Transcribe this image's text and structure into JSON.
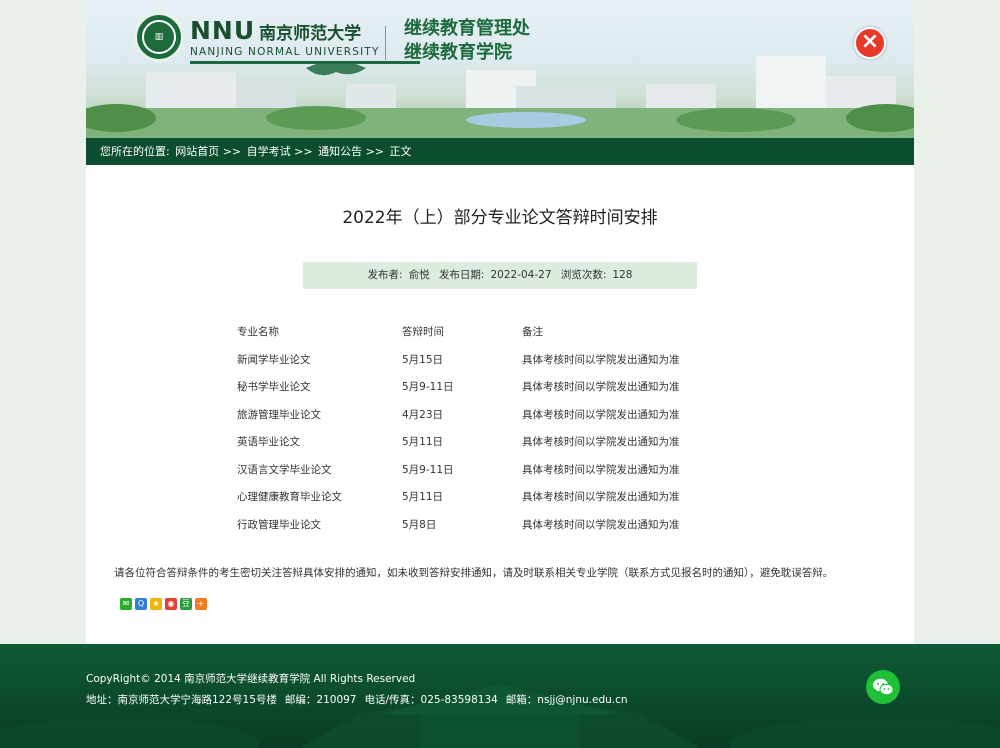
{
  "header": {
    "logo_text": "NNU",
    "brand_cn": "南京师范大学",
    "brand_en": "NANJING NORMAL UNIVERSITY",
    "office_line1": "继续教育管理处",
    "office_line2": "继续教育学院",
    "close_label": "×"
  },
  "breadcrumb": {
    "prefix": "您所在的位置:",
    "items": [
      "网站首页",
      "自学考试",
      "通知公告",
      "正文"
    ],
    "separator": ">>"
  },
  "article": {
    "title": "2022年（上）部分专业论文答辩时间安排",
    "meta": {
      "publisher_label": "发布者:",
      "publisher": "俞悦",
      "date_label": "发布日期:",
      "date": "2022-04-27",
      "views_label": "浏览次数:",
      "views": "128"
    },
    "table": {
      "headers": [
        "专业名称",
        "答辩时间",
        "备注"
      ],
      "rows": [
        [
          "新闻学毕业论文",
          "5月15日",
          "具体考核时间以学院发出通知为准"
        ],
        [
          "秘书学毕业论文",
          "5月9-11日",
          "具体考核时间以学院发出通知为准"
        ],
        [
          "旅游管理毕业论文",
          "4月23日",
          "具体考核时间以学院发出通知为准"
        ],
        [
          "英语毕业论文",
          "5月11日",
          "具体考核时间以学院发出通知为准"
        ],
        [
          "汉语言文学毕业论文",
          "5月9-11日",
          "具体考核时间以学院发出通知为准"
        ],
        [
          "心理健康教育毕业论文",
          "5月11日",
          "具体考核时间以学院发出通知为准"
        ],
        [
          "行政管理毕业论文",
          "5月8日",
          "具体考核时间以学院发出通知为准"
        ]
      ]
    },
    "notice": "请各位符合答辩条件的考生密切关注答辩具体安排的通知，如未收到答辩安排通知，请及时联系相关专业学院（联系方式见报名时的通知），避免耽误答辩。"
  },
  "share_icons": [
    {
      "name": "wechat-share-icon",
      "color": "#2aae2a"
    },
    {
      "name": "qq-share-icon",
      "color": "#2f7fd6"
    },
    {
      "name": "qzone-share-icon",
      "color": "#f2b705"
    },
    {
      "name": "weibo-share-icon",
      "color": "#e0413a"
    },
    {
      "name": "douban-share-icon",
      "color": "#2b9b3e"
    },
    {
      "name": "more-share-icon",
      "color": "#f47a20"
    }
  ],
  "footer": {
    "copyright": "CopyRight© 2014 南京师范大学继续教育学院 All Rights Reserved",
    "address": "地址：南京师范大学宁海路122号15号楼",
    "postcode": "邮编：210097",
    "phone": "电话/传真：025-83598134",
    "email": "邮箱：nsjj@njnu.edu.cn"
  },
  "colors": {
    "primary_green": "#0b4d2e",
    "meta_bg": "#dcecdf",
    "close_red": "#e53a2a",
    "wechat_green": "#1fc038"
  }
}
